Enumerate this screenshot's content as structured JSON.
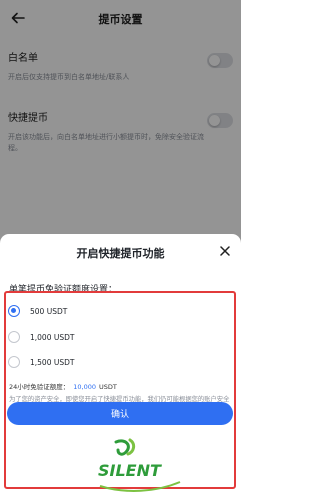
{
  "page": {
    "title": "提币设置",
    "whitelist": {
      "label": "白名单",
      "description": "开启后仅支持提币到白名单地址/联系人",
      "enabled": false
    },
    "quick_withdraw": {
      "label": "快捷提币",
      "description": "开启该功能后，向白名单地址进行小额提币时，免除安全验证流程。",
      "enabled": false
    }
  },
  "sheet": {
    "title": "开启快捷提币功能",
    "section_label": "单笔提币免验证额度设置：",
    "options": [
      {
        "label": "500 USDT",
        "selected": true
      },
      {
        "label": "1,000 USDT",
        "selected": false
      },
      {
        "label": "1,500 USDT",
        "selected": false
      }
    ],
    "daily_limit_label": "24小时免验证额度：",
    "daily_limit_value": "10,000",
    "daily_limit_unit": "USDT",
    "note": "为了您的资产安全，即使您开启了快捷提币功能，我们仍可能根据您的账户安全情况要求您进行安全验证。",
    "confirm_label": "确认"
  },
  "colors": {
    "accent": "#2f6ff2",
    "highlight": "#e23b3b"
  },
  "watermark": {
    "text": "SILENT"
  }
}
